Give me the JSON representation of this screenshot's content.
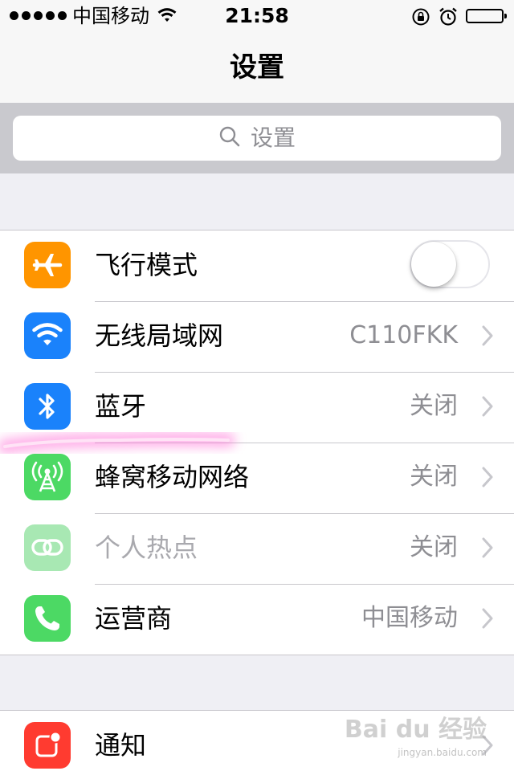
{
  "status_bar": {
    "carrier": "中国移动",
    "time": "21:58",
    "signal_dots": 5,
    "battery_level": 1.0
  },
  "nav": {
    "title": "设置"
  },
  "search": {
    "placeholder": "设置"
  },
  "groups": [
    {
      "rows": [
        {
          "label": "飞行模式",
          "icon": "airplane-icon",
          "icon_color": "#ff9500",
          "control": "toggle",
          "toggle_on": false
        },
        {
          "label": "无线局域网",
          "icon": "wifi-icon",
          "icon_color": "#1a82fb",
          "value": "C110FKK"
        },
        {
          "label": "蓝牙",
          "icon": "bluetooth-icon",
          "icon_color": "#1a82fb",
          "value": "关闭"
        },
        {
          "label": "蜂窝移动网络",
          "icon": "cellular-antenna-icon",
          "icon_color": "#4cd964",
          "value": "关闭"
        },
        {
          "label": "个人热点",
          "icon": "hotspot-link-icon",
          "icon_color": "#a8e8b3",
          "value": "关闭",
          "disabled": true
        },
        {
          "label": "运营商",
          "icon": "phone-icon",
          "icon_color": "#4cd964",
          "value": "中国移动"
        }
      ]
    },
    {
      "rows": [
        {
          "label": "通知",
          "icon": "notifications-icon",
          "icon_color": "#ff3b30"
        }
      ]
    }
  ],
  "watermark": {
    "text": "Bai du 经验",
    "sub": "jingyan.baidu.com"
  }
}
